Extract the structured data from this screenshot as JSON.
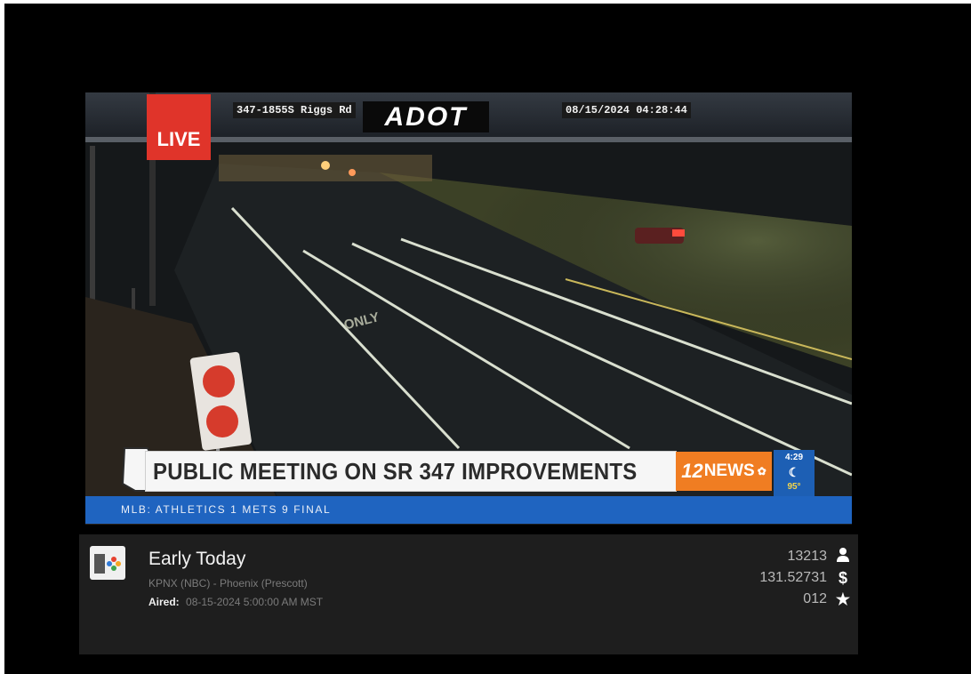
{
  "video": {
    "live_label": "LIVE",
    "camera_location": "347-1855S Riggs Rd",
    "camera_provider": "ADOT",
    "camera_timestamp": "08/15/2024  04:28:44",
    "road_marking": "ONLY",
    "headline": "PUBLIC MEETING ON SR 347 IMPROVEMENTS",
    "station_logo_number": "12",
    "station_logo_text": "NEWS",
    "weather_time": "4:29",
    "weather_temp": "95°",
    "ticker": "MLB: ATHLETICS 1  METS 9  FINAL"
  },
  "program": {
    "title": "Early Today",
    "station": "KPNX (NBC) - Phoenix (Prescott)",
    "aired_label": "Aired:",
    "aired_value": "08-15-2024 5:00:00 AM MST"
  },
  "stats": {
    "views": "13213",
    "value": "131.52731",
    "rating": "012"
  },
  "icons": {
    "views": "user-icon",
    "value": "dollar-icon",
    "rating": "star-icon"
  },
  "colors": {
    "live_red": "#e0342a",
    "station_orange": "#f07d22",
    "ticker_blue": "#1f64c0",
    "panel_bg": "#1e1e1e"
  }
}
